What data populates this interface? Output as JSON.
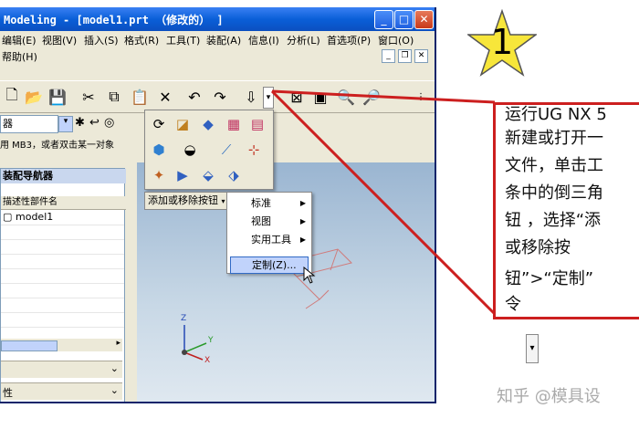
{
  "window": {
    "title": "Modeling - [model1.prt （修改的） ]",
    "controls": {
      "minimize": "_",
      "maximize": "□",
      "close": "✕"
    }
  },
  "menubar": {
    "items": [
      "编辑(E)",
      "视图(V)",
      "插入(S)",
      "格式(R)",
      "工具(T)",
      "装配(A)",
      "信息(I)",
      "分析(L)",
      "首选项(P)",
      "窗口(O)"
    ],
    "help": "帮助(H)"
  },
  "cue_line": "用 MB3，或者双击某一对象",
  "combo_value": "器",
  "navigator": {
    "title": "装配导航器",
    "column_header": "描述性部件名",
    "part": "model1"
  },
  "bottom_rows": [
    "",
    "性"
  ],
  "popup": {
    "add_remove_button": "添加或移除按钮",
    "submenu_items": [
      "标准",
      "视图",
      "实用工具"
    ],
    "customize": "定制(Z)..."
  },
  "axes": {
    "z": "Z",
    "y": "Y",
    "x": "X"
  },
  "annotation": {
    "number": "1",
    "lines": [
      "运行UG NX 5",
      "新建或打开一",
      "文件，单击工",
      "条中的倒三角",
      "钮 ，选择“添",
      "或移除按",
      "钮”>“定制”",
      "令"
    ]
  },
  "watermark": "知乎 @模具设",
  "colors": {
    "accent_red": "#cc1f1f",
    "title_blue": "#0a5fd8",
    "star_yellow": "#f7e63a"
  }
}
